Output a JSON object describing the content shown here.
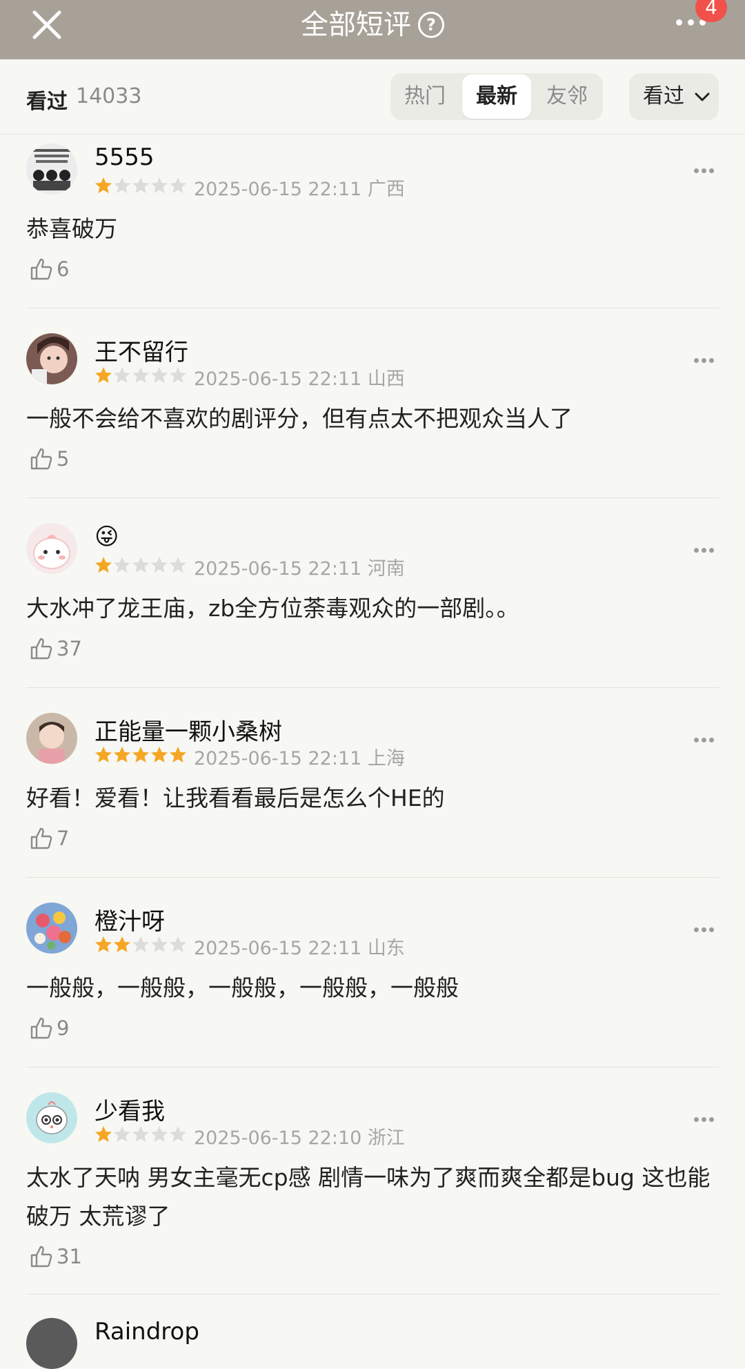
{
  "nav": {
    "title": "全部短评",
    "badge": "4"
  },
  "filter": {
    "seen_label": "看过",
    "seen_count": "14033",
    "tabs": [
      "热门",
      "最新",
      "友邻"
    ],
    "active_tab": "最新",
    "dropdown_label": "看过"
  },
  "reviews": [
    {
      "username": "5555",
      "rating": 1,
      "date": "2025-06-15 22:11",
      "region": "广西",
      "content": "恭喜破万",
      "likes": "6"
    },
    {
      "username": "王不留行",
      "rating": 1,
      "date": "2025-06-15 22:11",
      "region": "山西",
      "content": "一般不会给不喜欢的剧评分，但有点太不把观众当人了",
      "likes": "5"
    },
    {
      "username": "😜",
      "rating": 1,
      "date": "2025-06-15 22:11",
      "region": "河南",
      "content": "大水冲了龙王庙，zb全方位荼毒观众的一部剧。。",
      "likes": "37"
    },
    {
      "username": "正能量一颗小桑树",
      "rating": 5,
      "date": "2025-06-15 22:11",
      "region": "上海",
      "content": "好看！爱看！让我看看最后是怎么个HE的",
      "likes": "7"
    },
    {
      "username": "橙汁呀",
      "rating": 2,
      "date": "2025-06-15 22:11",
      "region": "山东",
      "content": "一般般，一般般，一般般，一般般，一般般",
      "likes": "9"
    },
    {
      "username": "少看我",
      "rating": 1,
      "date": "2025-06-15 22:10",
      "region": "浙江",
      "content": "太水了天呐 男女主毫无cp感 剧情一味为了爽而爽全都是bug 这也能破万 太荒谬了",
      "likes": "31"
    },
    {
      "username": "Raindrop"
    }
  ],
  "colors": {
    "nav_bg": "#a8a198",
    "star_filled": "#f5a623",
    "star_empty": "#dcdcd8",
    "badge": "#f2504a"
  }
}
